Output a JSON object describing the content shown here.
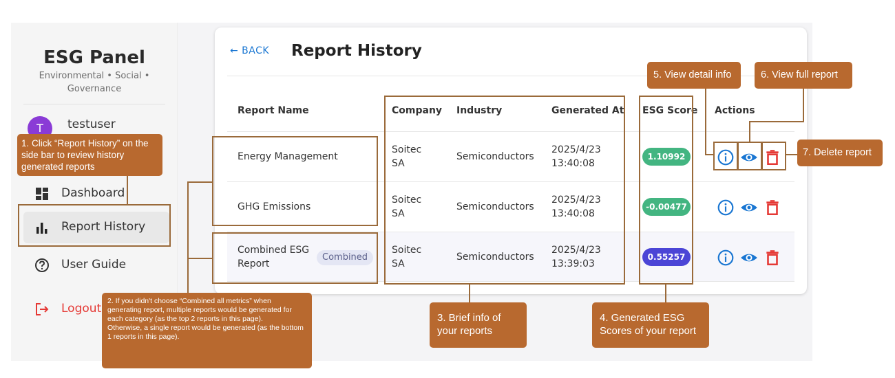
{
  "sidebar": {
    "title": "ESG Panel",
    "subtitle": "Environmental • Social • Governance",
    "avatar_letter": "T",
    "username": "testuser",
    "nav": [
      {
        "label": "Dashboard",
        "icon": "dashboard-icon"
      },
      {
        "label": "Report History",
        "icon": "bar-chart-icon"
      },
      {
        "label": "User Guide",
        "icon": "help-circle-icon"
      },
      {
        "label": "Logout",
        "icon": "logout-icon"
      }
    ]
  },
  "header": {
    "back_label": "← BACK",
    "title": "Report History"
  },
  "table": {
    "columns": [
      "Report Name",
      "Company",
      "Industry",
      "Generated At",
      "ESG Score",
      "Actions"
    ],
    "rows": [
      {
        "name": "Energy Management",
        "company_line1": "Soitec",
        "company_line2": "SA",
        "industry": "Semiconductors",
        "date": "2025/4/23",
        "time": "13:40:08",
        "score": "1.10992",
        "score_color": "#43b581"
      },
      {
        "name": "GHG Emissions",
        "company_line1": "Soitec",
        "company_line2": "SA",
        "industry": "Semiconductors",
        "date": "2025/4/23",
        "time": "13:40:08",
        "score": "-0.00477",
        "score_color": "#43b581"
      },
      {
        "name_line1": "Combined ESG",
        "name_line2": "Report",
        "chip": "Combined",
        "company_line1": "Soitec",
        "company_line2": "SA",
        "industry": "Semiconductors",
        "date": "2025/4/23",
        "time": "13:39:03",
        "score": "0.55257",
        "score_color": "#4b45d6"
      }
    ]
  },
  "annotations": {
    "a1": "1. Click “Report History” on the side bar to review history generated reports",
    "a2_line1": "2. If you didn't choose “Combined all metrics” when generating report, multiple reports would be generated for each category (as the top 2 reports in this page).",
    "a2_line2": "Otherwise, a single report would be generated (as the bottom 1 reports in this page).",
    "a3": "3. Brief info of your reports",
    "a4": "4. Generated ESG Scores of your report",
    "a5": "5. View detail info",
    "a6": "6. View full report",
    "a7": "7. Delete report"
  },
  "colors": {
    "accent_blue": "#1976d2",
    "delete_red": "#e53935",
    "callout": "#b8692f",
    "avatar": "#8a3bd6"
  }
}
